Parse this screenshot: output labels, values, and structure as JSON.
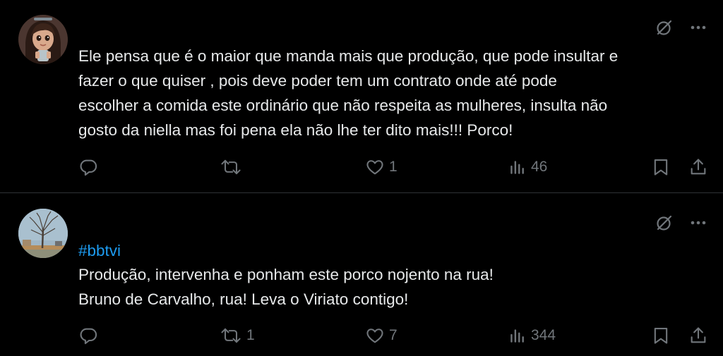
{
  "colors": {
    "background": "#000000",
    "text": "#e7e9ea",
    "muted": "#71767b",
    "hashtag": "#1d9bf0",
    "divider": "#2f3336"
  },
  "tweets": [
    {
      "avatar": "avatar-cartoon-girl",
      "hashtag": "",
      "text": "Ele pensa que é o maior que manda mais que produção, que pode insultar e\nfazer o que quiser , pois deve poder tem um contrato onde até pode\nescolher a comida este ordinário que não respeita as mulheres, insulta não\ngosto da niella mas foi pena ela não lhe ter dito mais!!! Porco!",
      "reply_count": "",
      "repost_count": "",
      "like_count": "1",
      "view_count": "46"
    },
    {
      "avatar": "avatar-tree-landscape",
      "hashtag": "#bbtvi",
      "text": "Produção, intervenha e ponham este porco nojento na rua!\nBruno de Carvalho, rua! Leva o Viriato contigo!",
      "reply_count": "",
      "repost_count": "1",
      "like_count": "7",
      "view_count": "344"
    }
  ],
  "icons": {
    "grok": "grok-icon",
    "more": "more-icon",
    "reply": "reply-icon",
    "repost": "repost-icon",
    "like": "heart-icon",
    "views": "views-icon",
    "bookmark": "bookmark-icon",
    "share": "share-icon"
  }
}
